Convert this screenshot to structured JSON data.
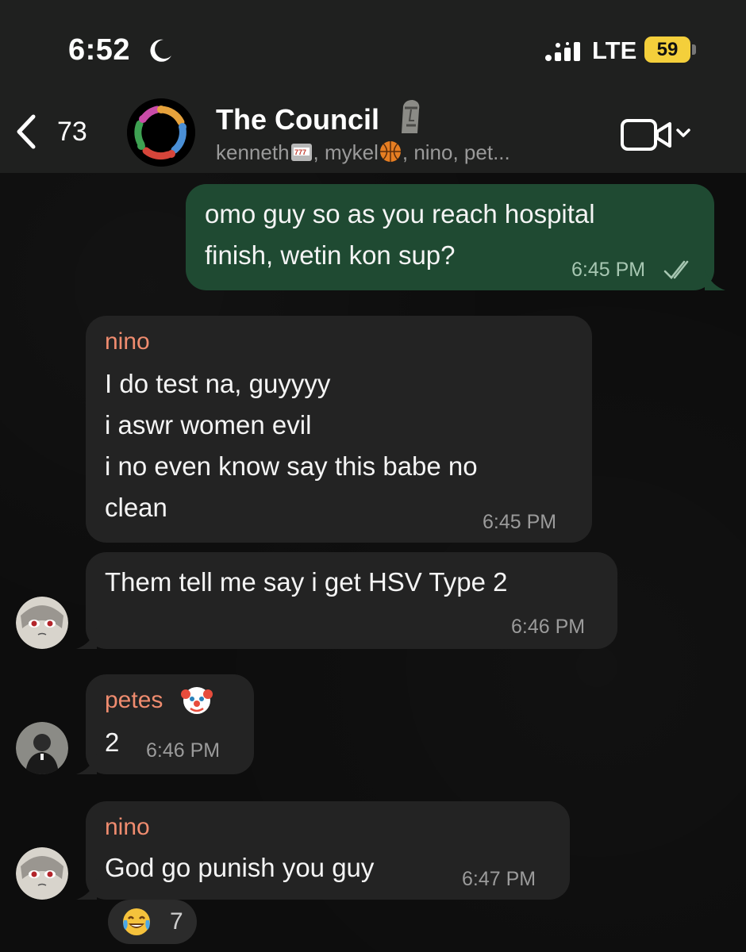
{
  "status_bar": {
    "time": "6:52",
    "network": "LTE",
    "battery": "59",
    "icons": [
      "moon-icon",
      "signal-icon"
    ]
  },
  "header": {
    "back_count": "73",
    "title": "The Council",
    "members_part1": "kenneth",
    "members_part2": ", mykel",
    "members_part3": ", nino, pet...",
    "icons": [
      "back-chevron-icon",
      "group-avatar",
      "moai-icon",
      "slot-machine-icon",
      "basketball-icon",
      "video-camera-icon",
      "chevron-down-icon"
    ]
  },
  "messages": [
    {
      "direction": "outgoing",
      "lines": [
        "omo guy so as you reach hospital",
        "finish, wetin kon sup?"
      ],
      "time": "6:45 PM",
      "status": "read"
    },
    {
      "direction": "incoming",
      "sender": "nino",
      "lines": [
        "I do test na, guyyyy",
        "i aswr women evil",
        "i no even know say this babe no",
        "clean"
      ],
      "time": "6:45 PM"
    },
    {
      "direction": "incoming",
      "lines": [
        "Them tell me say i get HSV Type 2"
      ],
      "time": "6:46 PM"
    },
    {
      "direction": "incoming",
      "sender": "petes",
      "lines": [
        "2"
      ],
      "time": "6:46 PM"
    },
    {
      "direction": "incoming",
      "sender": "nino",
      "lines": [
        "God go punish you guy"
      ],
      "time": "6:47 PM",
      "reaction": {
        "emoji": "joy-emoji",
        "count": "7"
      }
    }
  ],
  "colors": {
    "header_bg": "#1f201f",
    "outgoing_bubble": "#1f4a32",
    "incoming_bubble": "#232323",
    "sender_name": "#f08c6f",
    "battery": "#f4cf3b"
  }
}
